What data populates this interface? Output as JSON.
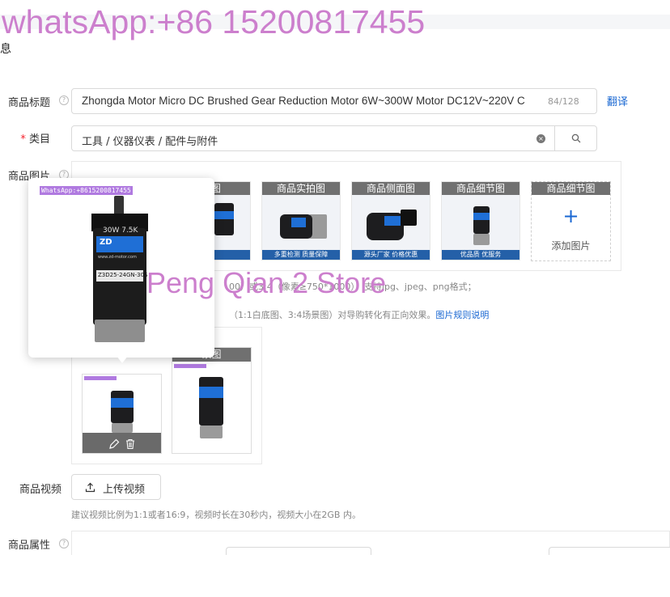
{
  "watermarks": {
    "top": "whatsApp:+86 15200817455",
    "middle": "Peng Qian 2 Store",
    "popup_tag": "WhatsApp:+8615200817455"
  },
  "section": {
    "partial_title": "息"
  },
  "title_field": {
    "label": "商品标题",
    "value": "Zhongda Motor Micro DC Brushed Gear Reduction Motor 6W~300W Motor DC12V~220V C",
    "counter": "84/128",
    "translate_link": "翻译"
  },
  "category_field": {
    "required_mark": "*",
    "label": "类目",
    "value": "工具 / 仪器仪表 / 配件与附件"
  },
  "images_field": {
    "label": "商品图片",
    "thumbs": [
      {
        "caption": "面图"
      },
      {
        "caption": "商品实拍图",
        "sub": "多重检测  质量保障"
      },
      {
        "caption": "商品侧面图",
        "sub": "源头厂家  价格优惠"
      },
      {
        "caption": "商品细节图",
        "sub": "优品质  优服务"
      }
    ],
    "add_tile": {
      "caption": "商品细节图",
      "plus": "+",
      "label": "添加图片"
    },
    "hint_1": "00）或3:4（像素≥750*1000），支持jpg、jpeg、png格式；",
    "hint_2_prefix": "（1:1白底图、3:4场景图）对导购转化有正向效果。",
    "hint_2_link": "图片规则说明"
  },
  "preview_popup": {
    "motor_label_top": "30W  7.5K",
    "brand": "ZD",
    "site": "www.zd-motor.com",
    "model": "Z3D25-24GN-30S"
  },
  "main_images": {
    "second_caption": "景图"
  },
  "video_field": {
    "label": "商品视频",
    "upload_button": "上传视频",
    "hint": "建议视频比例为1:1或者16:9，视频时长在30秒内，视频大小在2GB 内。"
  },
  "attributes_field": {
    "label": "商品属性"
  },
  "colors": {
    "link": "#1967d2",
    "watermark": "#cc7fcd",
    "required": "#f5222d"
  }
}
